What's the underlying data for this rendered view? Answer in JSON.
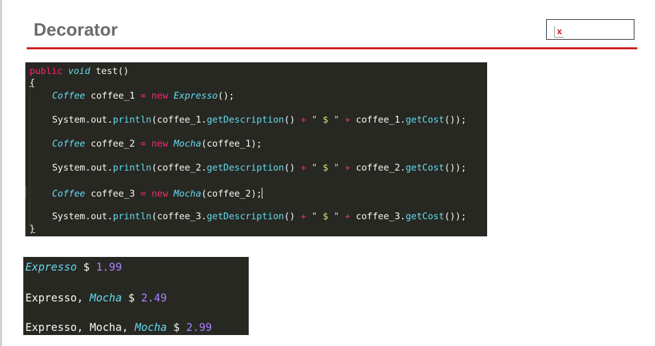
{
  "slide": {
    "title": "Decorator",
    "image_placeholder_icon": "broken-image-icon"
  },
  "colors": {
    "title_rule": "#cc1f1f",
    "code_background": "#272822",
    "keyword": "#f92672",
    "type": "#66d9ef",
    "number": "#ae81ff"
  },
  "code": {
    "l1": {
      "kw": "public",
      "ty": "void",
      "rest": " test()"
    },
    "open_brace": "{",
    "close_brace": "}",
    "l3": {
      "ty": "Coffee",
      "var": " coffee_1 ",
      "op": "=",
      "new": " new ",
      "cls": "Expresso",
      "end": "();"
    },
    "l4": {
      "a": "System.out.",
      "fn1": "println",
      "b": "(coffee_1.",
      "fn2": "getDescription",
      "c": "() ",
      "op1": "+",
      "s": " \" $ \" ",
      "op2": "+",
      "d": " coffee_1.",
      "fn3": "getCost",
      "e": "());"
    },
    "l5": {
      "ty": "Coffee",
      "var": " coffee_2 ",
      "op": "=",
      "new": " new ",
      "cls": "Mocha",
      "end": "(coffee_1);"
    },
    "l6": {
      "a": "System.out.",
      "fn1": "println",
      "b": "(coffee_2.",
      "fn2": "getDescription",
      "c": "() ",
      "op1": "+",
      "s": " \" $ \" ",
      "op2": "+",
      "d": " coffee_2.",
      "fn3": "getCost",
      "e": "());"
    },
    "l7": {
      "ty": "Coffee",
      "var": " coffee_3 ",
      "op": "=",
      "new": " new ",
      "cls": "Mocha",
      "end": "(coffee_2);"
    },
    "l8": {
      "a": "System.out.",
      "fn1": "println",
      "b": "(coffee_3.",
      "fn2": "getDescription",
      "c": "() ",
      "op1": "+",
      "s": " \" $ \" ",
      "op2": "+",
      "d": " coffee_3.",
      "fn3": "getCost",
      "e": "());"
    }
  },
  "output": {
    "o1": {
      "it": "Expresso",
      "sep": " $ ",
      "num": "1.99"
    },
    "o2": {
      "plain": "Expresso, ",
      "it": "Mocha",
      "sep": " $ ",
      "num": "2.49"
    },
    "o3": {
      "plain": "Expresso, Mocha, ",
      "it": "Mocha",
      "sep": " $ ",
      "num": "2.99"
    }
  }
}
